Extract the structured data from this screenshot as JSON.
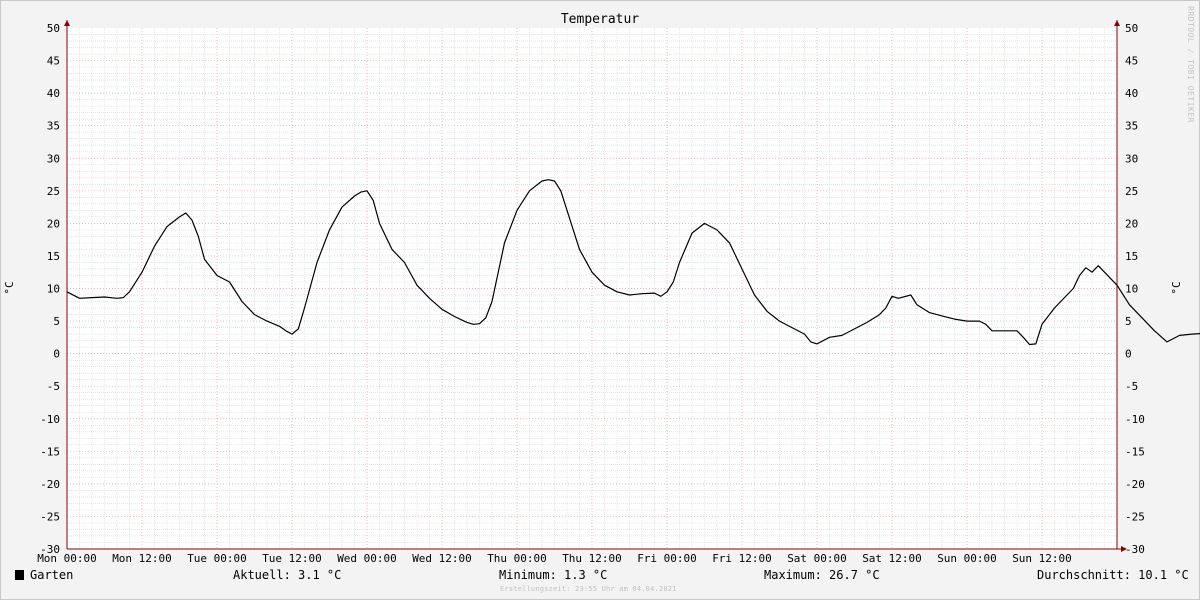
{
  "chart_data": {
    "type": "line",
    "title": "Temperatur",
    "ylabel": "°C",
    "ylim": [
      -30,
      50
    ],
    "yticks": [
      50,
      45,
      40,
      35,
      30,
      25,
      20,
      15,
      10,
      5,
      0,
      -5,
      -10,
      -15,
      -20,
      -25,
      -30
    ],
    "xticks": [
      "Mon 00:00",
      "Mon 12:00",
      "Tue 00:00",
      "Tue 12:00",
      "Wed 00:00",
      "Wed 12:00",
      "Thu 00:00",
      "Thu 12:00",
      "Fri 00:00",
      "Fri 12:00",
      "Sat 00:00",
      "Sat 12:00",
      "Sun 00:00",
      "Sun 12:00"
    ],
    "x_unit": "hours since Mon 00:00",
    "grid": true,
    "series": [
      {
        "name": "Garten",
        "color": "#000000",
        "points": [
          [
            0,
            9.5
          ],
          [
            2,
            8.5
          ],
          [
            4,
            8.6
          ],
          [
            6,
            8.7
          ],
          [
            8,
            8.5
          ],
          [
            9,
            8.6
          ],
          [
            10,
            9.5
          ],
          [
            12,
            12.5
          ],
          [
            14,
            16.5
          ],
          [
            16,
            19.5
          ],
          [
            18,
            21.0
          ],
          [
            19,
            21.6
          ],
          [
            20,
            20.5
          ],
          [
            21,
            18.0
          ],
          [
            22,
            14.5
          ],
          [
            24,
            12.0
          ],
          [
            26,
            11.0
          ],
          [
            28,
            8.0
          ],
          [
            30,
            6.0
          ],
          [
            32,
            5.0
          ],
          [
            34,
            4.2
          ],
          [
            35,
            3.5
          ],
          [
            36,
            3.0
          ],
          [
            37,
            3.8
          ],
          [
            38,
            7.0
          ],
          [
            40,
            14.0
          ],
          [
            42,
            19.0
          ],
          [
            44,
            22.5
          ],
          [
            46,
            24.2
          ],
          [
            47,
            24.8
          ],
          [
            48,
            25.0
          ],
          [
            49,
            23.5
          ],
          [
            50,
            20.0
          ],
          [
            52,
            16.0
          ],
          [
            54,
            14.0
          ],
          [
            56,
            10.5
          ],
          [
            58,
            8.5
          ],
          [
            60,
            6.8
          ],
          [
            62,
            5.7
          ],
          [
            64,
            4.8
          ],
          [
            65,
            4.5
          ],
          [
            66,
            4.6
          ],
          [
            67,
            5.5
          ],
          [
            68,
            8.0
          ],
          [
            70,
            17.0
          ],
          [
            72,
            22.0
          ],
          [
            74,
            25.0
          ],
          [
            76,
            26.5
          ],
          [
            77,
            26.7
          ],
          [
            78,
            26.5
          ],
          [
            79,
            25.0
          ],
          [
            80,
            22.0
          ],
          [
            82,
            16.0
          ],
          [
            84,
            12.5
          ],
          [
            86,
            10.5
          ],
          [
            88,
            9.5
          ],
          [
            90,
            9.0
          ],
          [
            92,
            9.2
          ],
          [
            94,
            9.3
          ],
          [
            95,
            8.8
          ],
          [
            96,
            9.5
          ],
          [
            97,
            11.0
          ],
          [
            98,
            14.0
          ],
          [
            100,
            18.5
          ],
          [
            102,
            20.0
          ],
          [
            104,
            19.0
          ],
          [
            106,
            17.0
          ],
          [
            108,
            13.0
          ],
          [
            110,
            9.0
          ],
          [
            112,
            6.5
          ],
          [
            114,
            5.0
          ],
          [
            116,
            4.0
          ],
          [
            118,
            3.0
          ],
          [
            119,
            1.8
          ],
          [
            120,
            1.5
          ],
          [
            122,
            2.5
          ],
          [
            124,
            2.8
          ],
          [
            126,
            3.8
          ],
          [
            128,
            4.8
          ],
          [
            130,
            6.0
          ],
          [
            131,
            7.0
          ],
          [
            132,
            8.8
          ],
          [
            133,
            8.5
          ],
          [
            135,
            9.0
          ],
          [
            136,
            7.5
          ],
          [
            138,
            6.3
          ],
          [
            140,
            5.8
          ],
          [
            142,
            5.3
          ],
          [
            144,
            5.0
          ],
          [
            146,
            5.0
          ],
          [
            147,
            4.5
          ],
          [
            148,
            3.5
          ],
          [
            150,
            3.5
          ],
          [
            152,
            3.5
          ],
          [
            153,
            2.5
          ],
          [
            154,
            1.4
          ],
          [
            155,
            1.5
          ],
          [
            156,
            4.5
          ],
          [
            158,
            7.0
          ],
          [
            160,
            9.0
          ],
          [
            161,
            10.0
          ],
          [
            162,
            12.0
          ],
          [
            163,
            13.2
          ],
          [
            164,
            12.5
          ],
          [
            165,
            13.5
          ],
          [
            166,
            12.5
          ],
          [
            168,
            10.5
          ],
          [
            170,
            7.5
          ],
          [
            172,
            5.5
          ],
          [
            174,
            3.5
          ],
          [
            176,
            1.8
          ],
          [
            177,
            2.3
          ],
          [
            178,
            2.8
          ],
          [
            180,
            3.0
          ],
          [
            182,
            3.1
          ],
          [
            184,
            3.2
          ],
          [
            186,
            4.0
          ],
          [
            188,
            4.8
          ],
          [
            190,
            5.5
          ],
          [
            191,
            6.5
          ],
          [
            192,
            7.0
          ],
          [
            193,
            8.5
          ],
          [
            194,
            8.8
          ],
          [
            196,
            8.9
          ],
          [
            197,
            8.0
          ],
          [
            198,
            6.5
          ],
          [
            200,
            4.5
          ],
          [
            201,
            3.2
          ],
          [
            202,
            3.3
          ],
          [
            203,
            3.0
          ],
          [
            203.9,
            3.1
          ]
        ]
      }
    ]
  },
  "legend": {
    "series_name": "Garten",
    "current": "Aktuell: 3.1 °C",
    "minimum": "Minimum: 1.3 °C",
    "maximum": "Maximum: 26.7 °C",
    "average": "Durchschnitt: 10.1 °C"
  },
  "footer": {
    "created": "Erstellungszeit: 23:55 Uhr am 04.04.2021"
  },
  "watermark": "RRDTOOL / TOBI OETIKER"
}
